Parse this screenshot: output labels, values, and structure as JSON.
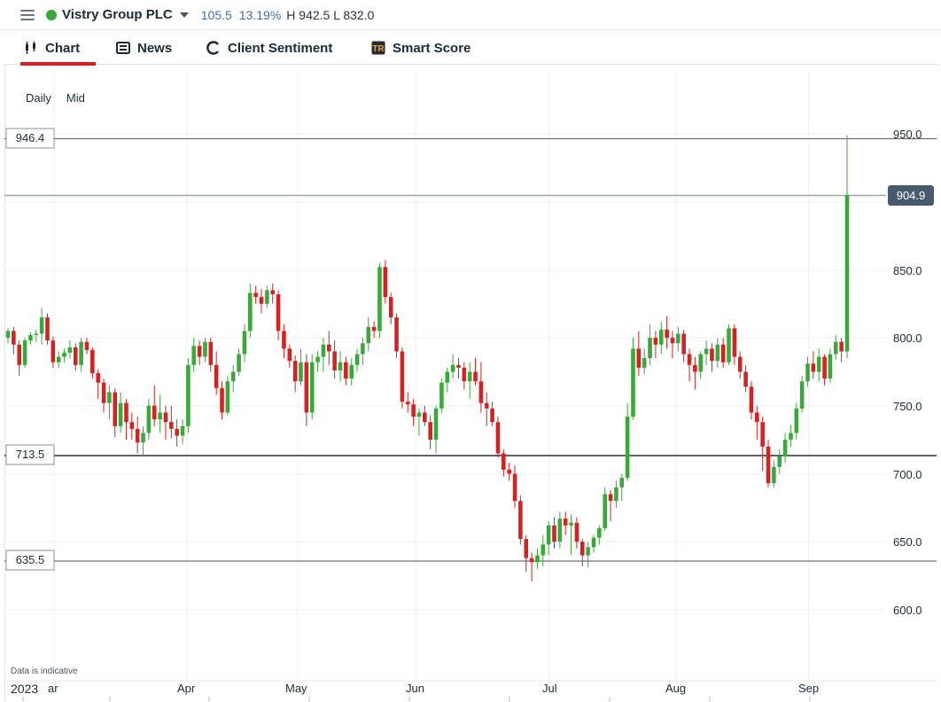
{
  "header": {
    "instrument": "Vistry Group PLC",
    "change": "105.5",
    "change_pct": "13.19%",
    "high_low": "H 942.5  L 832.0",
    "status_color": "#3aa83a"
  },
  "tabs": [
    {
      "label": "Chart",
      "icon": "candlestick-chart-icon",
      "active": true
    },
    {
      "label": "News",
      "icon": "newspaper-icon",
      "active": false
    },
    {
      "label": "Client Sentiment",
      "icon": "sentiment-gauge-icon",
      "active": false
    },
    {
      "label": "Smart Score",
      "icon": "smart-score-icon",
      "active": false
    }
  ],
  "chart_options": {
    "interval": "Daily",
    "price_type": "Mid"
  },
  "chart_data": {
    "type": "candlestick",
    "y_ticks": [
      "950.0",
      "850.0",
      "800.0",
      "750.0",
      "700.0",
      "650.0",
      "600.0"
    ],
    "x_labels": [
      "ar",
      "Apr",
      "May",
      "Jun",
      "Jul",
      "Aug",
      "Sep"
    ],
    "year_label": "2023",
    "current_price": "904.9",
    "levels": [
      "946.4",
      "713.5",
      "635.5"
    ],
    "disclaimer": "Data is indicative",
    "colors": {
      "up": "#3aa83a",
      "down": "#d42222",
      "current": "#4a5a6e"
    },
    "candles": [
      [
        800,
        807,
        796,
        805
      ],
      [
        805,
        808,
        788,
        795
      ],
      [
        795,
        798,
        772,
        780
      ],
      [
        780,
        800,
        778,
        798
      ],
      [
        798,
        804,
        795,
        802
      ],
      [
        802,
        806,
        797,
        803
      ],
      [
        803,
        822,
        795,
        815
      ],
      [
        815,
        818,
        795,
        798
      ],
      [
        798,
        801,
        778,
        782
      ],
      [
        782,
        790,
        778,
        786
      ],
      [
        786,
        792,
        782,
        789
      ],
      [
        789,
        798,
        785,
        793
      ],
      [
        793,
        796,
        776,
        780
      ],
      [
        780,
        800,
        775,
        797
      ],
      [
        797,
        800,
        788,
        791
      ],
      [
        791,
        793,
        770,
        774
      ],
      [
        774,
        777,
        755,
        767
      ],
      [
        767,
        770,
        745,
        752
      ],
      [
        752,
        765,
        740,
        760
      ],
      [
        760,
        763,
        727,
        735
      ],
      [
        735,
        760,
        730,
        752
      ],
      [
        752,
        755,
        725,
        738
      ],
      [
        738,
        745,
        725,
        733
      ],
      [
        733,
        742,
        715,
        723
      ],
      [
        723,
        735,
        713,
        730
      ],
      [
        730,
        755,
        725,
        750
      ],
      [
        750,
        765,
        735,
        740
      ],
      [
        740,
        758,
        730,
        745
      ],
      [
        745,
        750,
        725,
        738
      ],
      [
        738,
        750,
        726,
        733
      ],
      [
        733,
        740,
        720,
        728
      ],
      [
        728,
        740,
        722,
        735
      ],
      [
        735,
        785,
        730,
        780
      ],
      [
        780,
        800,
        775,
        794
      ],
      [
        794,
        798,
        780,
        786
      ],
      [
        786,
        800,
        782,
        797
      ],
      [
        797,
        800,
        775,
        780
      ],
      [
        780,
        790,
        758,
        763
      ],
      [
        763,
        768,
        740,
        745
      ],
      [
        745,
        772,
        743,
        768
      ],
      [
        768,
        780,
        760,
        775
      ],
      [
        775,
        792,
        772,
        788
      ],
      [
        788,
        810,
        782,
        805
      ],
      [
        805,
        840,
        800,
        833
      ],
      [
        833,
        838,
        825,
        830
      ],
      [
        830,
        836,
        818,
        825
      ],
      [
        825,
        838,
        822,
        835
      ],
      [
        835,
        840,
        825,
        832
      ],
      [
        832,
        835,
        798,
        805
      ],
      [
        805,
        810,
        785,
        792
      ],
      [
        792,
        795,
        778,
        783
      ],
      [
        783,
        787,
        760,
        768
      ],
      [
        768,
        792,
        765,
        782
      ],
      [
        782,
        788,
        735,
        745
      ],
      [
        745,
        788,
        740,
        782
      ],
      [
        782,
        790,
        775,
        786
      ],
      [
        786,
        800,
        775,
        795
      ],
      [
        795,
        805,
        780,
        790
      ],
      [
        790,
        798,
        770,
        776
      ],
      [
        776,
        790,
        768,
        782
      ],
      [
        782,
        786,
        765,
        770
      ],
      [
        770,
        785,
        765,
        780
      ],
      [
        780,
        792,
        775,
        788
      ],
      [
        788,
        800,
        780,
        796
      ],
      [
        796,
        815,
        790,
        808
      ],
      [
        808,
        812,
        800,
        805
      ],
      [
        805,
        855,
        800,
        852
      ],
      [
        852,
        857,
        825,
        830
      ],
      [
        830,
        833,
        810,
        815
      ],
      [
        815,
        818,
        785,
        790
      ],
      [
        790,
        793,
        748,
        753
      ],
      [
        753,
        760,
        745,
        751
      ],
      [
        751,
        755,
        735,
        742
      ],
      [
        742,
        748,
        728,
        745
      ],
      [
        745,
        750,
        735,
        738
      ],
      [
        738,
        743,
        718,
        725
      ],
      [
        725,
        750,
        715,
        748
      ],
      [
        748,
        770,
        745,
        767
      ],
      [
        767,
        778,
        760,
        775
      ],
      [
        775,
        788,
        770,
        780
      ],
      [
        780,
        785,
        770,
        778
      ],
      [
        778,
        782,
        762,
        768
      ],
      [
        768,
        782,
        755,
        775
      ],
      [
        775,
        785,
        765,
        768
      ],
      [
        768,
        782,
        745,
        752
      ],
      [
        752,
        760,
        735,
        748
      ],
      [
        748,
        753,
        735,
        738
      ],
      [
        738,
        742,
        712,
        715
      ],
      [
        715,
        718,
        698,
        703
      ],
      [
        703,
        708,
        695,
        700
      ],
      [
        700,
        706,
        675,
        680
      ],
      [
        680,
        684,
        648,
        652
      ],
      [
        652,
        655,
        628,
        638
      ],
      [
        638,
        642,
        621,
        635
      ],
      [
        635,
        645,
        630,
        640
      ],
      [
        640,
        655,
        632,
        648
      ],
      [
        648,
        665,
        640,
        662
      ],
      [
        662,
        668,
        645,
        650
      ],
      [
        650,
        672,
        645,
        667
      ],
      [
        667,
        672,
        655,
        662
      ],
      [
        662,
        670,
        640,
        664
      ],
      [
        664,
        668,
        645,
        650
      ],
      [
        650,
        652,
        632,
        640
      ],
      [
        640,
        650,
        631,
        646
      ],
      [
        646,
        655,
        642,
        653
      ],
      [
        653,
        662,
        648,
        660
      ],
      [
        660,
        690,
        658,
        685
      ],
      [
        685,
        688,
        665,
        680
      ],
      [
        680,
        695,
        675,
        690
      ],
      [
        690,
        700,
        680,
        697
      ],
      [
        697,
        752,
        695,
        742
      ],
      [
        742,
        800,
        740,
        792
      ],
      [
        792,
        805,
        772,
        778
      ],
      [
        778,
        792,
        773,
        785
      ],
      [
        785,
        810,
        780,
        800
      ],
      [
        800,
        805,
        785,
        795
      ],
      [
        795,
        812,
        788,
        806
      ],
      [
        806,
        816,
        792,
        800
      ],
      [
        800,
        805,
        785,
        796
      ],
      [
        796,
        808,
        790,
        803
      ],
      [
        803,
        806,
        782,
        788
      ],
      [
        788,
        792,
        768,
        780
      ],
      [
        780,
        786,
        762,
        775
      ],
      [
        775,
        790,
        770,
        788
      ],
      [
        788,
        798,
        780,
        792
      ],
      [
        792,
        796,
        775,
        783
      ],
      [
        783,
        800,
        778,
        795
      ],
      [
        795,
        800,
        778,
        782
      ],
      [
        782,
        810,
        780,
        807
      ],
      [
        807,
        810,
        780,
        786
      ],
      [
        786,
        790,
        770,
        775
      ],
      [
        775,
        780,
        760,
        764
      ],
      [
        764,
        768,
        740,
        745
      ],
      [
        745,
        750,
        725,
        738
      ],
      [
        738,
        742,
        702,
        720
      ],
      [
        720,
        725,
        690,
        693
      ],
      [
        693,
        710,
        690,
        705
      ],
      [
        705,
        718,
        700,
        713
      ],
      [
        713,
        730,
        708,
        725
      ],
      [
        725,
        736,
        720,
        730
      ],
      [
        730,
        752,
        725,
        748
      ],
      [
        748,
        772,
        745,
        768
      ],
      [
        768,
        786,
        764,
        781
      ],
      [
        781,
        790,
        770,
        775
      ],
      [
        775,
        792,
        768,
        786
      ],
      [
        786,
        788,
        765,
        770
      ],
      [
        770,
        792,
        767,
        788
      ],
      [
        788,
        802,
        784,
        797
      ],
      [
        797,
        800,
        782,
        790
      ],
      [
        790,
        949,
        785,
        904.9
      ]
    ]
  }
}
